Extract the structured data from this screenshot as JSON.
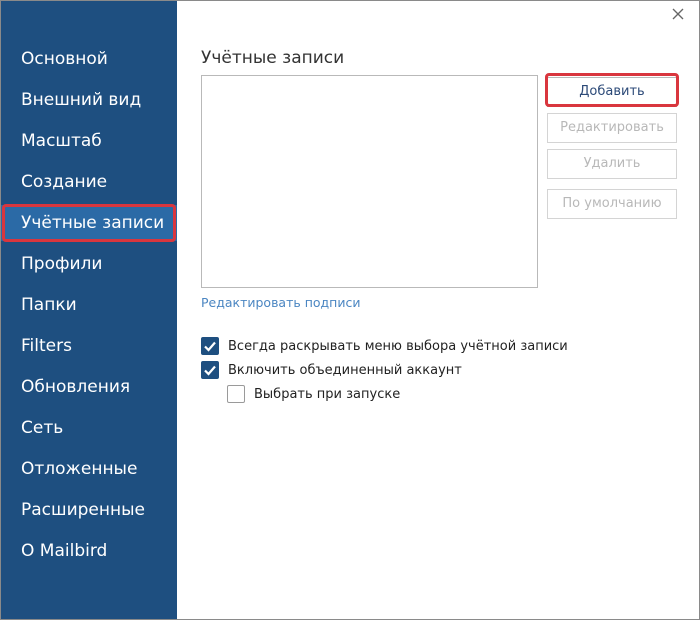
{
  "sidebar": {
    "items": [
      {
        "label": "Основной"
      },
      {
        "label": "Внешний вид"
      },
      {
        "label": "Масштаб"
      },
      {
        "label": "Создание"
      },
      {
        "label": "Учётные записи"
      },
      {
        "label": "Профили"
      },
      {
        "label": "Папки"
      },
      {
        "label": "Filters"
      },
      {
        "label": "Обновления"
      },
      {
        "label": "Сеть"
      },
      {
        "label": "Отложенные"
      },
      {
        "label": "Расширенные"
      },
      {
        "label": "О Mailbird"
      }
    ],
    "active_item": "Учётные записи",
    "background_color": "#1e4f80",
    "active_color": "#2b6aa6"
  },
  "window": {
    "close_icon": "close-icon"
  },
  "main": {
    "title": "Учётные записи",
    "buttons": {
      "add": "Добавить",
      "edit": "Редактировать",
      "delete": "Удалить",
      "default": "По умолчанию"
    },
    "edit_signatures_link": "Редактировать подписи",
    "options": {
      "always_expand": {
        "label": "Всегда раскрывать меню выбора учётной записи",
        "checked": true
      },
      "unified_account": {
        "label": "Включить объединенный аккаунт",
        "checked": true
      },
      "select_on_startup": {
        "label": "Выбрать при запуске",
        "checked": false
      }
    }
  },
  "colors": {
    "highlight": "#d9363e",
    "link": "#4b86c2",
    "checkbox": "#1e4f80"
  }
}
